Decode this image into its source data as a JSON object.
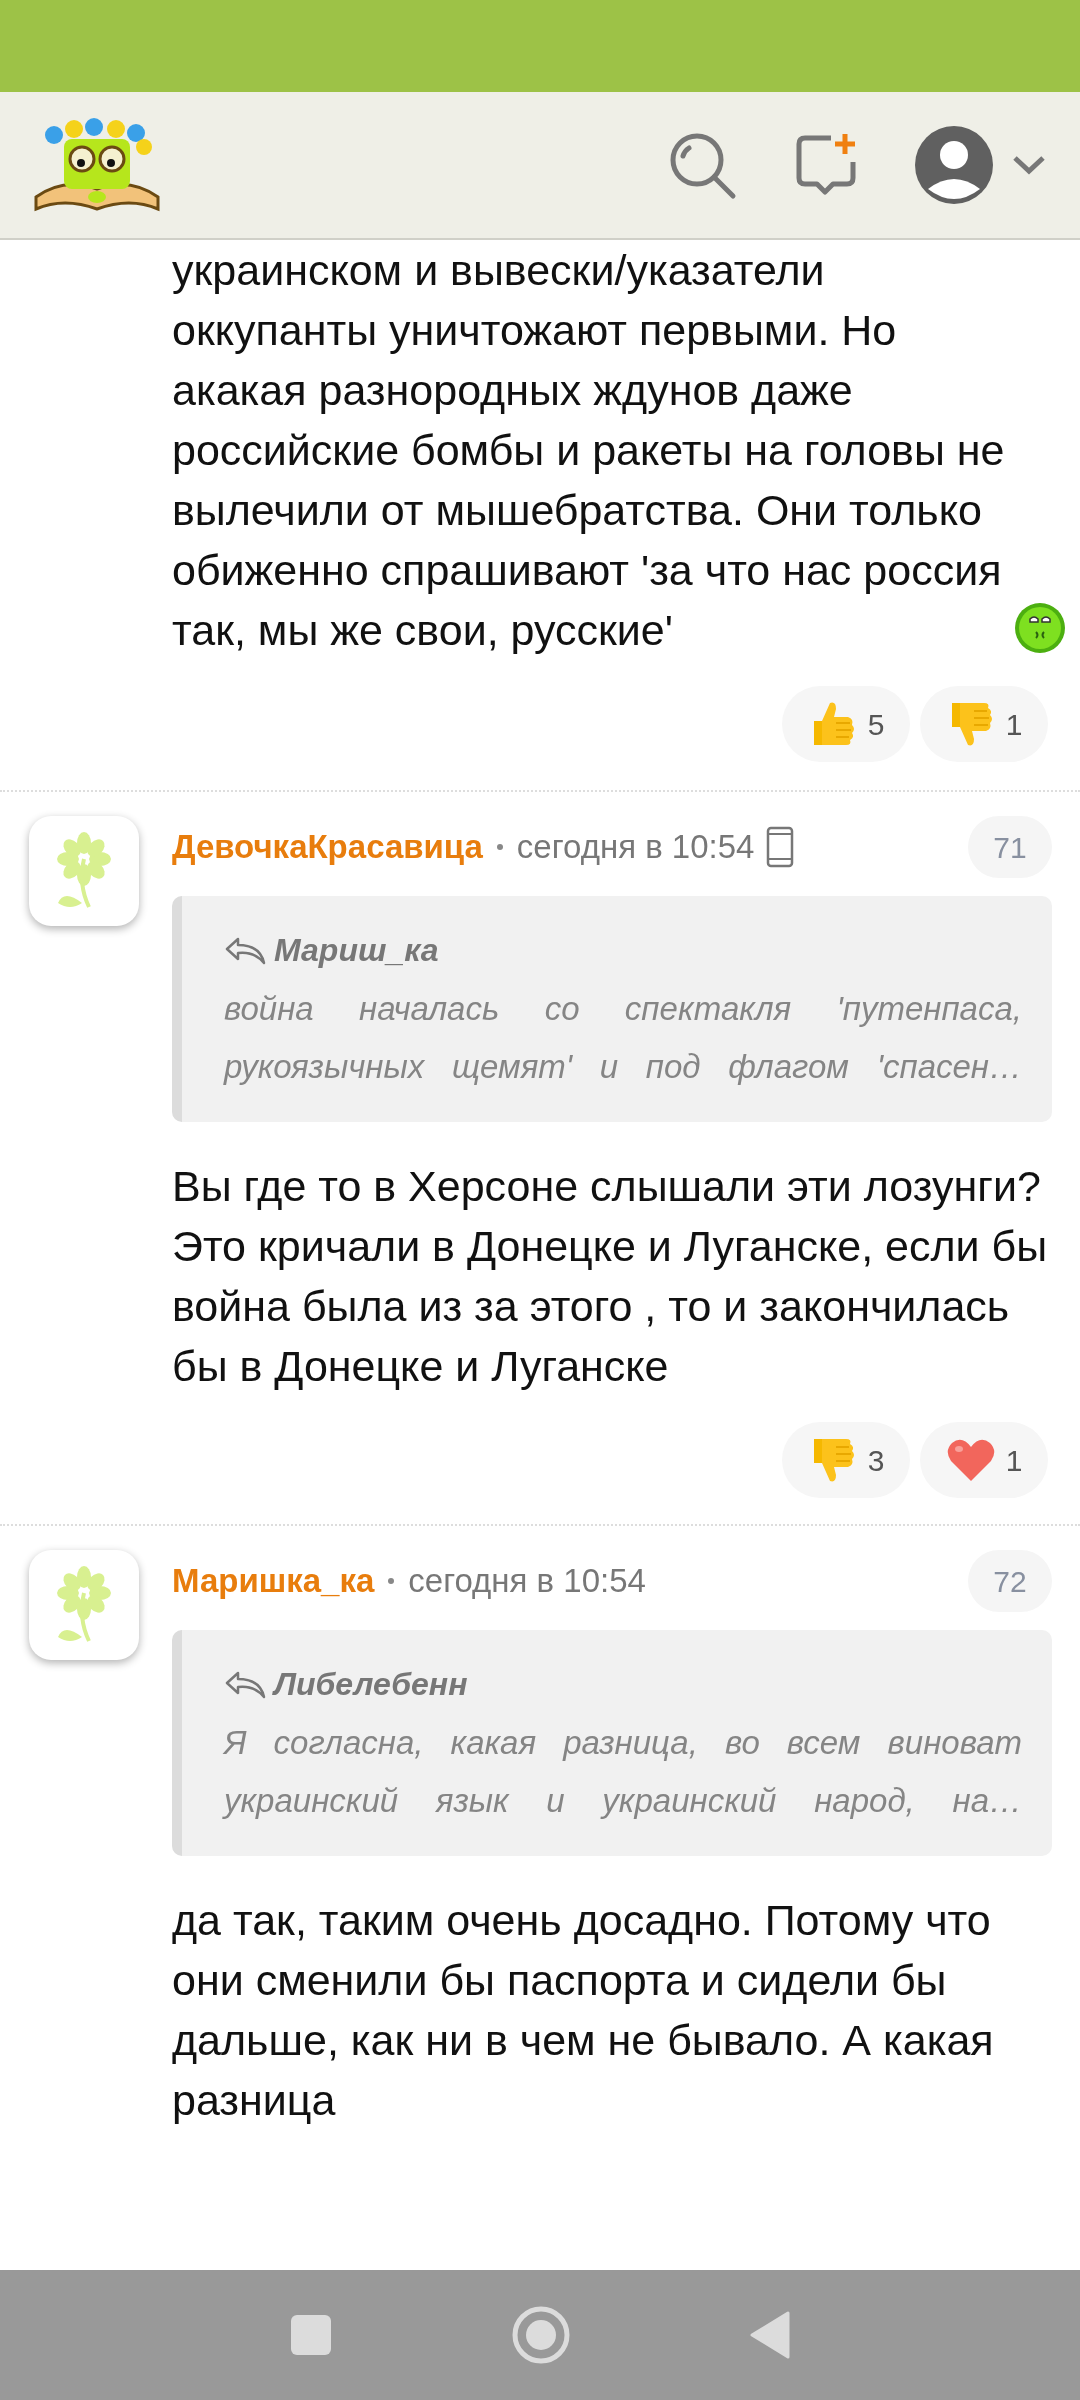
{
  "first_comment_tail": {
    "text": "украинском и вывески/указатели оккупанты уничтожают первыми. Но акакая разнородных ждунов даже российские бомбы и ракеты на головы не вылечили от мышебратства. Они только обиженно спрашивают 'за что нас россия так, мы же свои, русские'",
    "reactions": [
      {
        "kind": "thumbs-up",
        "count": "5"
      },
      {
        "kind": "thumbs-down",
        "count": "1"
      }
    ]
  },
  "comments": [
    {
      "author": "ДевочкаКрасавица",
      "time": "сегодня в 10:54",
      "mobile": true,
      "number": "71",
      "quote": {
        "author": "Мариш_ка",
        "text": "война началась со спектакля 'путенпаса, рукоязычных щемят' и под флагом 'спасен…"
      },
      "text": "Вы где то в Херсоне слышали эти лозунги? Это кричали в Донецке и Луганске, если бы война была из за этого , то и закончилась бы в Донецке и Луганске",
      "reactions": [
        {
          "kind": "thumbs-down",
          "count": "3"
        },
        {
          "kind": "heart",
          "count": "1"
        }
      ]
    },
    {
      "author": "Маришка_ка",
      "time": "сегодня в 10:54",
      "mobile": false,
      "number": "72",
      "quote": {
        "author": "Либелебенн",
        "text": "Я согласна, какая разница, во всем виноват украинский язык и украинский народ, на…"
      },
      "text": "да так, таким очень досадно. Потому что они сменили бы паспорта и сидели бы дальше, как ни в чем не бывало. А какая разница"
    }
  ]
}
